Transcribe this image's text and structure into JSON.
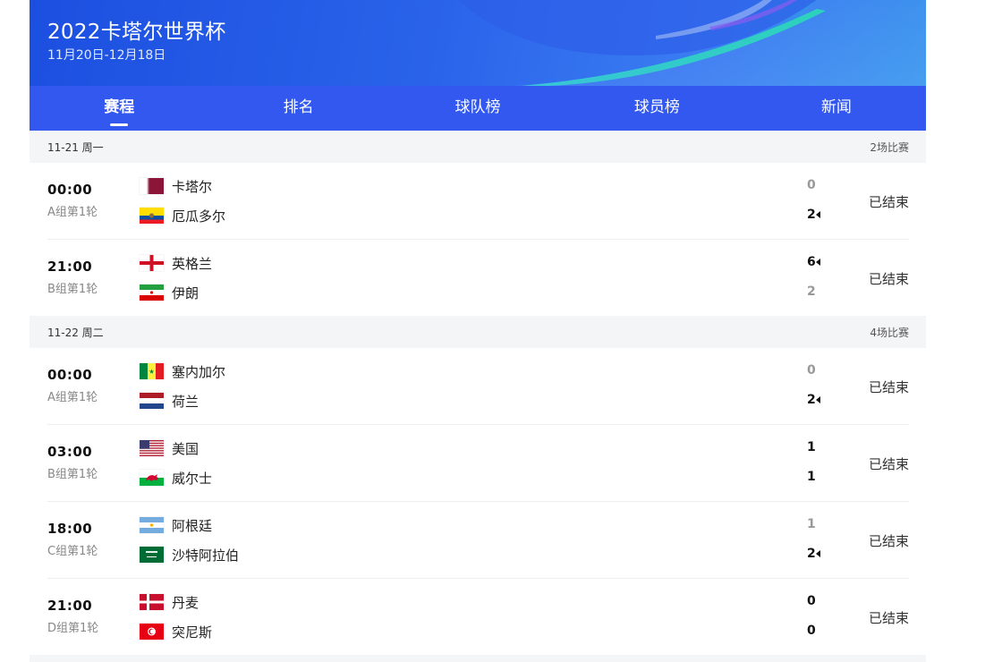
{
  "header": {
    "title": "2022卡塔尔世界杯",
    "dates": "11月20日-12月18日"
  },
  "tabs": [
    {
      "label": "赛程",
      "active": true
    },
    {
      "label": "排名"
    },
    {
      "label": "球队榜"
    },
    {
      "label": "球员榜"
    },
    {
      "label": "新闻"
    }
  ],
  "days": [
    {
      "date": "11-21 周一",
      "count": "2场比赛",
      "matches": [
        {
          "time": "00:00",
          "group": "A组第1轮",
          "status": "已结束",
          "home": {
            "name": "卡塔尔",
            "flag": "qatar-flag-icon",
            "score": "0"
          },
          "away": {
            "name": "厄瓜多尔",
            "flag": "ecuador-flag-icon",
            "score": "2"
          },
          "winner": "away"
        },
        {
          "time": "21:00",
          "group": "B组第1轮",
          "status": "已结束",
          "home": {
            "name": "英格兰",
            "flag": "england-flag-icon",
            "score": "6"
          },
          "away": {
            "name": "伊朗",
            "flag": "iran-flag-icon",
            "score": "2"
          },
          "winner": "home"
        }
      ]
    },
    {
      "date": "11-22 周二",
      "count": "4场比赛",
      "matches": [
        {
          "time": "00:00",
          "group": "A组第1轮",
          "status": "已结束",
          "home": {
            "name": "塞内加尔",
            "flag": "senegal-flag-icon",
            "score": "0"
          },
          "away": {
            "name": "荷兰",
            "flag": "netherlands-flag-icon",
            "score": "2"
          },
          "winner": "away"
        },
        {
          "time": "03:00",
          "group": "B组第1轮",
          "status": "已结束",
          "home": {
            "name": "美国",
            "flag": "usa-flag-icon",
            "score": "1"
          },
          "away": {
            "name": "威尔士",
            "flag": "wales-flag-icon",
            "score": "1"
          },
          "winner": "draw"
        },
        {
          "time": "18:00",
          "group": "C组第1轮",
          "status": "已结束",
          "home": {
            "name": "阿根廷",
            "flag": "argentina-flag-icon",
            "score": "1"
          },
          "away": {
            "name": "沙特阿拉伯",
            "flag": "saudi-arabia-flag-icon",
            "score": "2"
          },
          "winner": "away"
        },
        {
          "time": "21:00",
          "group": "D组第1轮",
          "status": "已结束",
          "home": {
            "name": "丹麦",
            "flag": "denmark-flag-icon",
            "score": "0"
          },
          "away": {
            "name": "突尼斯",
            "flag": "tunisia-flag-icon",
            "score": "0"
          },
          "winner": "draw"
        }
      ]
    }
  ],
  "colors": {
    "banner": "#2a63ea",
    "tabs_bg": "#3358f0",
    "day_bg": "#f4f5f7",
    "score_lose": "#999999"
  }
}
